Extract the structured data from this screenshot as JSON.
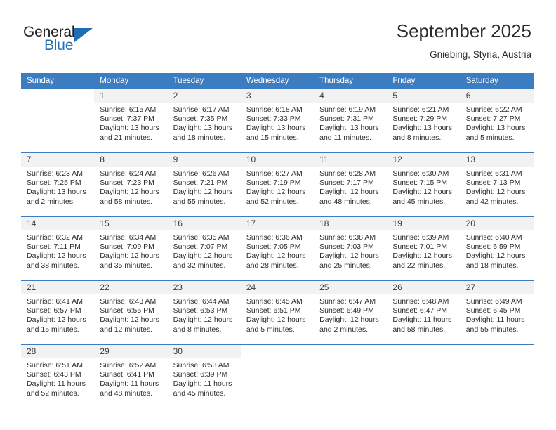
{
  "brand": {
    "name_top": "General",
    "name_bottom": "Blue",
    "triangle_color": "#1f6db5",
    "text_color": "#231f20",
    "blue_color": "#2572b8"
  },
  "header": {
    "title": "September 2025",
    "subtitle": "Gniebing, Styria, Austria"
  },
  "theme": {
    "header_bg": "#3b7dc0",
    "header_text": "#ffffff",
    "daynum_band_bg": "#f2f2f2",
    "grid_line": "#3b7dc0",
    "body_text": "#2d2d2d"
  },
  "calendar": {
    "weekday_headers": [
      "Sunday",
      "Monday",
      "Tuesday",
      "Wednesday",
      "Thursday",
      "Friday",
      "Saturday"
    ],
    "weeks": [
      [
        {
          "day": "",
          "sunrise": "",
          "sunset": "",
          "daylight_line1": "",
          "daylight_line2": "",
          "blank": true
        },
        {
          "day": "1",
          "sunrise": "Sunrise: 6:15 AM",
          "sunset": "Sunset: 7:37 PM",
          "daylight_line1": "Daylight: 13 hours",
          "daylight_line2": "and 21 minutes."
        },
        {
          "day": "2",
          "sunrise": "Sunrise: 6:17 AM",
          "sunset": "Sunset: 7:35 PM",
          "daylight_line1": "Daylight: 13 hours",
          "daylight_line2": "and 18 minutes."
        },
        {
          "day": "3",
          "sunrise": "Sunrise: 6:18 AM",
          "sunset": "Sunset: 7:33 PM",
          "daylight_line1": "Daylight: 13 hours",
          "daylight_line2": "and 15 minutes."
        },
        {
          "day": "4",
          "sunrise": "Sunrise: 6:19 AM",
          "sunset": "Sunset: 7:31 PM",
          "daylight_line1": "Daylight: 13 hours",
          "daylight_line2": "and 11 minutes."
        },
        {
          "day": "5",
          "sunrise": "Sunrise: 6:21 AM",
          "sunset": "Sunset: 7:29 PM",
          "daylight_line1": "Daylight: 13 hours",
          "daylight_line2": "and 8 minutes."
        },
        {
          "day": "6",
          "sunrise": "Sunrise: 6:22 AM",
          "sunset": "Sunset: 7:27 PM",
          "daylight_line1": "Daylight: 13 hours",
          "daylight_line2": "and 5 minutes."
        }
      ],
      [
        {
          "day": "7",
          "sunrise": "Sunrise: 6:23 AM",
          "sunset": "Sunset: 7:25 PM",
          "daylight_line1": "Daylight: 13 hours",
          "daylight_line2": "and 2 minutes."
        },
        {
          "day": "8",
          "sunrise": "Sunrise: 6:24 AM",
          "sunset": "Sunset: 7:23 PM",
          "daylight_line1": "Daylight: 12 hours",
          "daylight_line2": "and 58 minutes."
        },
        {
          "day": "9",
          "sunrise": "Sunrise: 6:26 AM",
          "sunset": "Sunset: 7:21 PM",
          "daylight_line1": "Daylight: 12 hours",
          "daylight_line2": "and 55 minutes."
        },
        {
          "day": "10",
          "sunrise": "Sunrise: 6:27 AM",
          "sunset": "Sunset: 7:19 PM",
          "daylight_line1": "Daylight: 12 hours",
          "daylight_line2": "and 52 minutes."
        },
        {
          "day": "11",
          "sunrise": "Sunrise: 6:28 AM",
          "sunset": "Sunset: 7:17 PM",
          "daylight_line1": "Daylight: 12 hours",
          "daylight_line2": "and 48 minutes."
        },
        {
          "day": "12",
          "sunrise": "Sunrise: 6:30 AM",
          "sunset": "Sunset: 7:15 PM",
          "daylight_line1": "Daylight: 12 hours",
          "daylight_line2": "and 45 minutes."
        },
        {
          "day": "13",
          "sunrise": "Sunrise: 6:31 AM",
          "sunset": "Sunset: 7:13 PM",
          "daylight_line1": "Daylight: 12 hours",
          "daylight_line2": "and 42 minutes."
        }
      ],
      [
        {
          "day": "14",
          "sunrise": "Sunrise: 6:32 AM",
          "sunset": "Sunset: 7:11 PM",
          "daylight_line1": "Daylight: 12 hours",
          "daylight_line2": "and 38 minutes."
        },
        {
          "day": "15",
          "sunrise": "Sunrise: 6:34 AM",
          "sunset": "Sunset: 7:09 PM",
          "daylight_line1": "Daylight: 12 hours",
          "daylight_line2": "and 35 minutes."
        },
        {
          "day": "16",
          "sunrise": "Sunrise: 6:35 AM",
          "sunset": "Sunset: 7:07 PM",
          "daylight_line1": "Daylight: 12 hours",
          "daylight_line2": "and 32 minutes."
        },
        {
          "day": "17",
          "sunrise": "Sunrise: 6:36 AM",
          "sunset": "Sunset: 7:05 PM",
          "daylight_line1": "Daylight: 12 hours",
          "daylight_line2": "and 28 minutes."
        },
        {
          "day": "18",
          "sunrise": "Sunrise: 6:38 AM",
          "sunset": "Sunset: 7:03 PM",
          "daylight_line1": "Daylight: 12 hours",
          "daylight_line2": "and 25 minutes."
        },
        {
          "day": "19",
          "sunrise": "Sunrise: 6:39 AM",
          "sunset": "Sunset: 7:01 PM",
          "daylight_line1": "Daylight: 12 hours",
          "daylight_line2": "and 22 minutes."
        },
        {
          "day": "20",
          "sunrise": "Sunrise: 6:40 AM",
          "sunset": "Sunset: 6:59 PM",
          "daylight_line1": "Daylight: 12 hours",
          "daylight_line2": "and 18 minutes."
        }
      ],
      [
        {
          "day": "21",
          "sunrise": "Sunrise: 6:41 AM",
          "sunset": "Sunset: 6:57 PM",
          "daylight_line1": "Daylight: 12 hours",
          "daylight_line2": "and 15 minutes."
        },
        {
          "day": "22",
          "sunrise": "Sunrise: 6:43 AM",
          "sunset": "Sunset: 6:55 PM",
          "daylight_line1": "Daylight: 12 hours",
          "daylight_line2": "and 12 minutes."
        },
        {
          "day": "23",
          "sunrise": "Sunrise: 6:44 AM",
          "sunset": "Sunset: 6:53 PM",
          "daylight_line1": "Daylight: 12 hours",
          "daylight_line2": "and 8 minutes."
        },
        {
          "day": "24",
          "sunrise": "Sunrise: 6:45 AM",
          "sunset": "Sunset: 6:51 PM",
          "daylight_line1": "Daylight: 12 hours",
          "daylight_line2": "and 5 minutes."
        },
        {
          "day": "25",
          "sunrise": "Sunrise: 6:47 AM",
          "sunset": "Sunset: 6:49 PM",
          "daylight_line1": "Daylight: 12 hours",
          "daylight_line2": "and 2 minutes."
        },
        {
          "day": "26",
          "sunrise": "Sunrise: 6:48 AM",
          "sunset": "Sunset: 6:47 PM",
          "daylight_line1": "Daylight: 11 hours",
          "daylight_line2": "and 58 minutes."
        },
        {
          "day": "27",
          "sunrise": "Sunrise: 6:49 AM",
          "sunset": "Sunset: 6:45 PM",
          "daylight_line1": "Daylight: 11 hours",
          "daylight_line2": "and 55 minutes."
        }
      ],
      [
        {
          "day": "28",
          "sunrise": "Sunrise: 6:51 AM",
          "sunset": "Sunset: 6:43 PM",
          "daylight_line1": "Daylight: 11 hours",
          "daylight_line2": "and 52 minutes."
        },
        {
          "day": "29",
          "sunrise": "Sunrise: 6:52 AM",
          "sunset": "Sunset: 6:41 PM",
          "daylight_line1": "Daylight: 11 hours",
          "daylight_line2": "and 48 minutes."
        },
        {
          "day": "30",
          "sunrise": "Sunrise: 6:53 AM",
          "sunset": "Sunset: 6:39 PM",
          "daylight_line1": "Daylight: 11 hours",
          "daylight_line2": "and 45 minutes."
        },
        {
          "day": "",
          "sunrise": "",
          "sunset": "",
          "daylight_line1": "",
          "daylight_line2": "",
          "blank": true
        },
        {
          "day": "",
          "sunrise": "",
          "sunset": "",
          "daylight_line1": "",
          "daylight_line2": "",
          "blank": true
        },
        {
          "day": "",
          "sunrise": "",
          "sunset": "",
          "daylight_line1": "",
          "daylight_line2": "",
          "blank": true
        },
        {
          "day": "",
          "sunrise": "",
          "sunset": "",
          "daylight_line1": "",
          "daylight_line2": "",
          "blank": true
        }
      ]
    ]
  }
}
